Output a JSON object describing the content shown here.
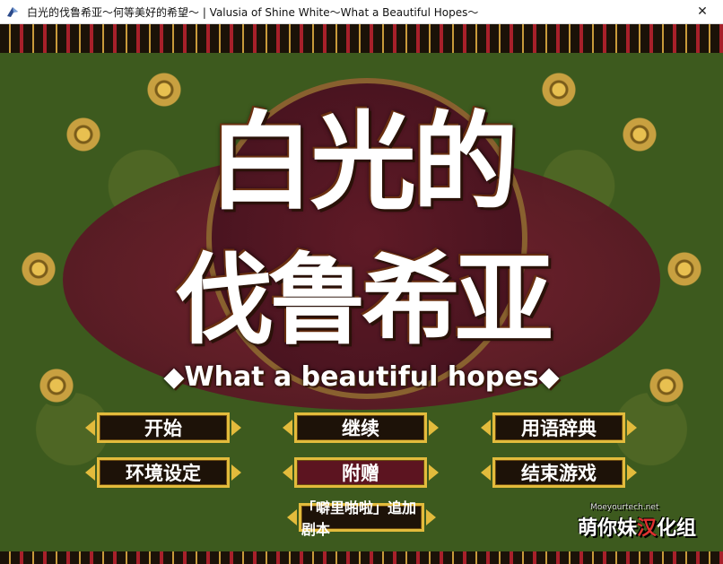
{
  "window": {
    "title": "白光的伐鲁希亚～何等美好的希望～ | Valusia of Shine White～What a Beautiful Hopes～",
    "close_symbol": "✕"
  },
  "game": {
    "title_line1": "白光的",
    "title_line2": "伐鲁希亚",
    "subtitle": "◆What a beautiful hopes◆"
  },
  "menu": {
    "start": "开始",
    "continue": "继续",
    "glossary": "用语辞典",
    "settings": "环境设定",
    "bonus": "附赠",
    "quit": "结束游戏",
    "extra_scenario": "「噼里啪啦」追加剧本"
  },
  "logo": {
    "part1": "萌你妹",
    "part2": "汉",
    "part3": "化组",
    "url": "Moeyourtech.net"
  },
  "colors": {
    "accent_gold": "#e3bb3c",
    "bg_green": "#3d5a1e",
    "medallion_red": "#7a2030"
  }
}
